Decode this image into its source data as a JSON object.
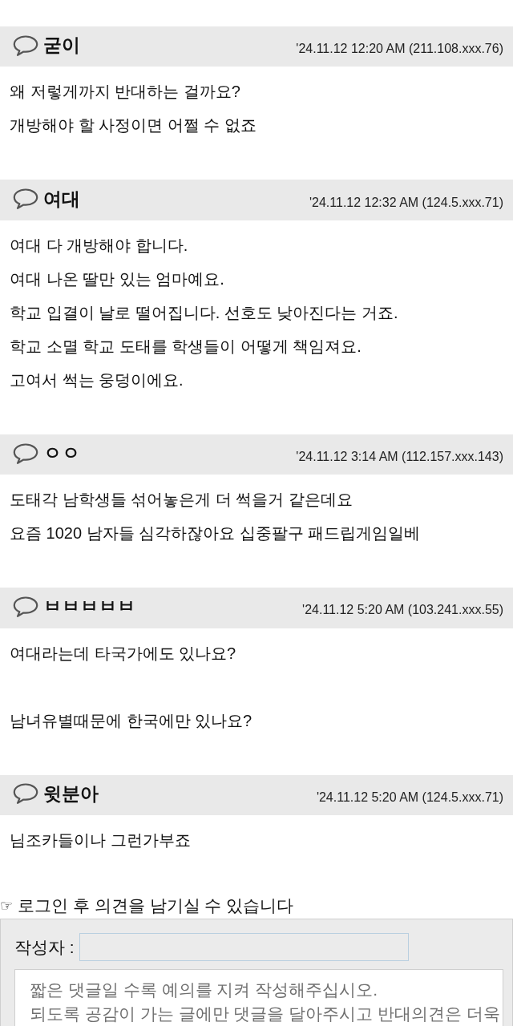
{
  "comments": [
    {
      "author": "굳이",
      "meta": "'24.11.12 12:20 AM (211.108.xxx.76)",
      "paragraphs": [
        [
          "왜 저렇게까지 반대하는 걸까요?",
          "개방해야 할 사정이면 어쩔 수 없죠"
        ]
      ]
    },
    {
      "author": "여대",
      "meta": "'24.11.12 12:32 AM (124.5.xxx.71)",
      "paragraphs": [
        [
          "여대 다 개방해야 합니다.",
          "여대 나온 딸만 있는 엄마예요.",
          "학교 입결이 날로 떨어집니다. 선호도 낮아진다는 거죠.",
          "학교 소멸 학교 도태를 학생들이 어떻게 책임져요.",
          "고여서 썩는 웅덩이에요."
        ]
      ]
    },
    {
      "author": "ㅇㅇ",
      "meta": "'24.11.12 3:14 AM (112.157.xxx.143)",
      "paragraphs": [
        [
          "도태각 남학생들 섞어놓은게 더 썩을거 같은데요",
          "요즘 1020 남자들 심각하잖아요 십중팔구 패드립게임일베"
        ]
      ]
    },
    {
      "author": "ㅂㅂㅂㅂㅂ",
      "meta": "'24.11.12 5:20 AM (103.241.xxx.55)",
      "paragraphs": [
        [
          "여대라는데 타국가에도 있나요?"
        ],
        [
          "남녀유별때문에 한국에만 있나요?"
        ]
      ]
    },
    {
      "author": "윗분아",
      "meta": "'24.11.12 5:20 AM (124.5.xxx.71)",
      "paragraphs": [
        [
          "님조카들이나 그런가부죠"
        ]
      ]
    }
  ],
  "login_notice": {
    "icon": "☞",
    "text": "로그인 후 의견을 남기실 수 있습니다"
  },
  "comment_form": {
    "author_label": "작성자 :",
    "comment_placeholder": "짧은 댓글일 수록 예의를 지켜 작성해주십시오.\n되도록 공감이 가는 글에만 댓글을 달아주시고 반대의견은 더욱"
  }
}
